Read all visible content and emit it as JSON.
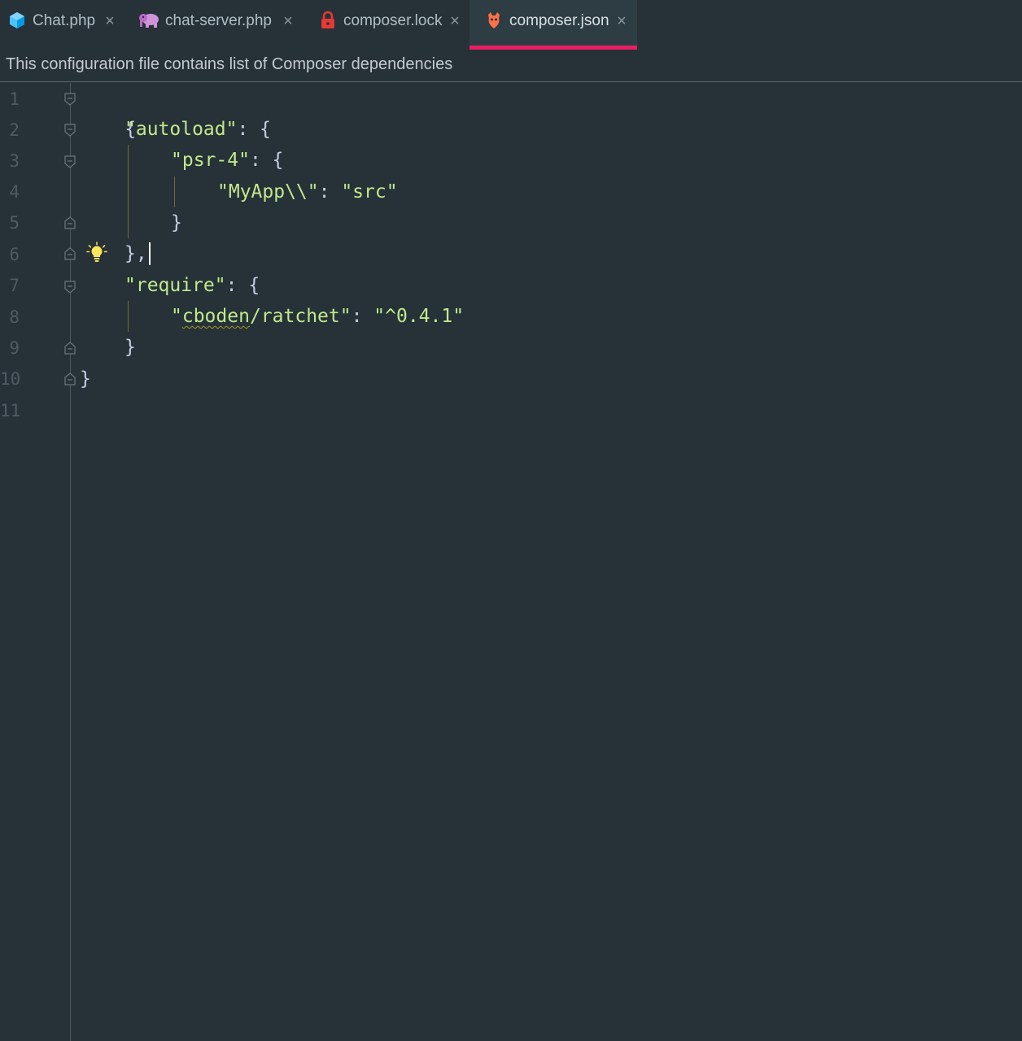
{
  "tabs": [
    {
      "label": "Chat.php",
      "icon": "php-class-icon",
      "active": false
    },
    {
      "label": "chat-server.php",
      "icon": "php-elephant-icon",
      "active": false
    },
    {
      "label": "composer.lock",
      "icon": "lock-icon",
      "active": false
    },
    {
      "label": "composer.json",
      "icon": "composer-icon",
      "active": true
    }
  ],
  "close_glyph": "×",
  "notification": {
    "text": "This configuration file contains list of Composer dependencies"
  },
  "editor": {
    "line_numbers": [
      "1",
      "2",
      "3",
      "4",
      "5",
      "6",
      "7",
      "8",
      "9",
      "10",
      "11"
    ],
    "code": {
      "l1": "{",
      "l2_key": "\"autoload\"",
      "l2_rest": ": {",
      "l3_key": "\"psr-4\"",
      "l3_rest": ": {",
      "l4_key": "\"MyApp\\\\\"",
      "l4_sep": ": ",
      "l4_val": "\"src\"",
      "l5": "}",
      "l6": "},",
      "l7_key": "\"require\"",
      "l7_rest": ": {",
      "l8_q1": "\"",
      "l8_warn": "cboden",
      "l8_key_rest": "/ratchet\"",
      "l8_sep": ": ",
      "l8_val": "\"^0.4.1\"",
      "l9": "}",
      "l10": "}"
    }
  },
  "colors": {
    "background": "#263238",
    "active_tab_underline": "#e91e63",
    "string": "#c3e88d",
    "line_number": "#4f5b62"
  }
}
